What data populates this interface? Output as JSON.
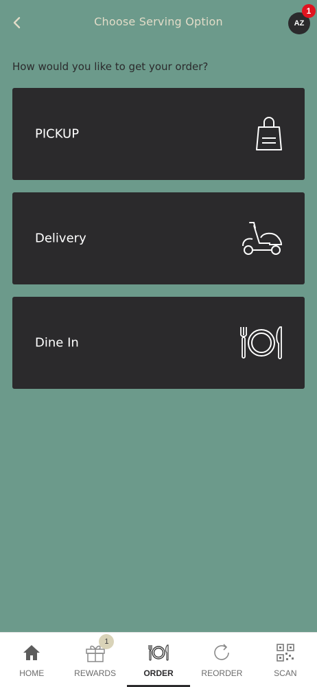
{
  "header": {
    "title": "Choose Serving Option",
    "avatar_initials": "AZ",
    "notification_count": "1"
  },
  "prompt": "How would you like to get your order?",
  "options": [
    {
      "label": "PICKUP",
      "icon": "shopping-bag-icon"
    },
    {
      "label": "Delivery",
      "icon": "scooter-icon"
    },
    {
      "label": "Dine In",
      "icon": "fork-plate-knife-icon"
    }
  ],
  "nav": {
    "items": [
      {
        "label": "HOME",
        "icon": "home-icon"
      },
      {
        "label": "REWARDS",
        "icon": "gift-icon",
        "badge": "1"
      },
      {
        "label": "ORDER",
        "icon": "dining-icon",
        "active": true
      },
      {
        "label": "REORDER",
        "icon": "reorder-icon"
      },
      {
        "label": "SCAN",
        "icon": "qr-code-icon"
      }
    ]
  },
  "colors": {
    "background": "#6c9a8b",
    "card": "#2b2a2c",
    "title_text": "#e2dcc8",
    "badge_red": "#e0141f",
    "rewards_badge": "#d9d3b8"
  }
}
